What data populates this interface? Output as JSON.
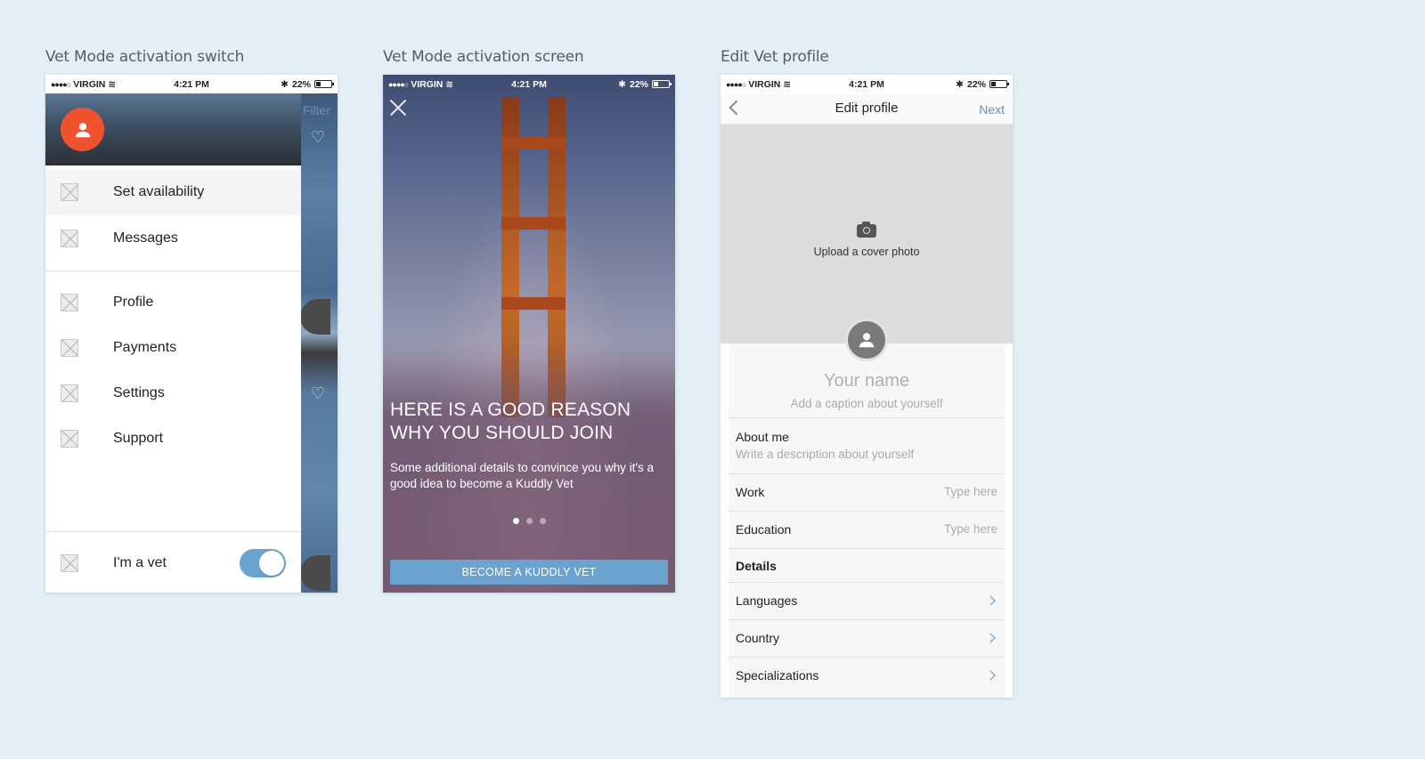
{
  "captions": {
    "switch": "Vet Mode activation switch",
    "screen": "Vet Mode activation screen",
    "edit": "Edit Vet profile"
  },
  "status_bar": {
    "carrier": "VIRGIN",
    "signal": "●●●●○",
    "time": "4:21 PM",
    "battery": "22%",
    "bluetooth": "✱"
  },
  "drawer": {
    "filter": "Filter",
    "items": [
      {
        "label": "Set availability",
        "icon": "x-placeholder-icon"
      },
      {
        "label": "Messages",
        "icon": "x-placeholder-icon"
      },
      {
        "label": "Profile",
        "icon": "x-placeholder-icon"
      },
      {
        "label": "Payments",
        "icon": "x-placeholder-icon"
      },
      {
        "label": "Settings",
        "icon": "x-placeholder-icon"
      },
      {
        "label": "Support",
        "icon": "x-placeholder-icon"
      }
    ],
    "vet_toggle_label": "I'm a vet",
    "vet_toggle_on": true,
    "accent": "#f0522d",
    "toggle_color": "#6aa3cf"
  },
  "activation": {
    "headline_1": "HERE IS A GOOD REASON",
    "headline_2": "WHY YOU SHOULD JOIN",
    "sub_1": "Some additional details to convince you why it's a",
    "sub_2": "good idea to become a Kuddly Vet",
    "pages": 3,
    "current_page": 1,
    "cta": "BECOME A KUDDLY VET"
  },
  "edit_profile": {
    "title": "Edit profile",
    "next": "Next",
    "upload": "Upload a cover photo",
    "name_placeholder": "Your name",
    "caption_placeholder": "Add a caption about yourself",
    "about_label": "About me",
    "about_placeholder": "Write a description about yourself",
    "work_label": "Work",
    "work_placeholder": "Type here",
    "education_label": "Education",
    "education_placeholder": "Type here",
    "details_label": "Details",
    "languages": "Languages",
    "country": "Country",
    "specializations": "Specializations",
    "link_color": "#5b93c7"
  }
}
